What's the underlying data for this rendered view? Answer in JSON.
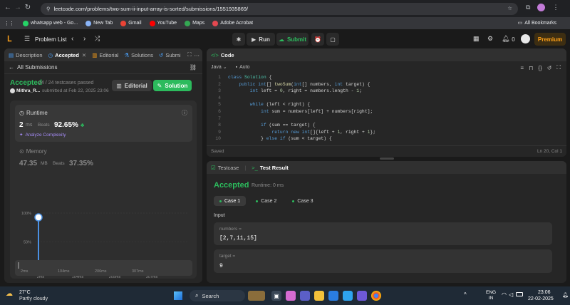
{
  "browser": {
    "url": "leetcode.com/problems/two-sum-ii-input-array-is-sorted/submissions/1551935869/",
    "bookmarks": [
      "whatsapp web - Go...",
      "New Tab",
      "Gmail",
      "YouTube",
      "Maps",
      "Adobe Acrobat"
    ],
    "all_bookmarks": "All Bookmarks"
  },
  "header": {
    "problem_list": "Problem List",
    "run": "Run",
    "submit": "Submit",
    "fire_count": "0",
    "premium": "Premium"
  },
  "left_tabs": {
    "description": "Description",
    "accepted": "Accepted",
    "editorial": "Editorial",
    "solutions": "Solutions",
    "submissions": "Submi"
  },
  "submission": {
    "all_submissions": "All Submissions",
    "status": "Accepted",
    "testcases": "24 / 24 testcases passed",
    "user": "Mithra_R...",
    "submitted_at": "submitted at Feb 22, 2025 23:06",
    "editorial_btn": "Editorial",
    "solution_btn": "Solution",
    "runtime_label": "Runtime",
    "runtime_value": "2",
    "runtime_unit": "ms",
    "beats_label": "Beats",
    "runtime_beats": "92.65%",
    "analyze": "Analyze Complexity",
    "memory_label": "Memory",
    "memory_value": "47.35",
    "memory_unit": "MB",
    "memory_beats": "37.35%"
  },
  "chart_data": {
    "type": "bar",
    "y_ticks": [
      "100%",
      "50%",
      "0%"
    ],
    "x_ticks": [
      "2ms",
      "104ms",
      "205ms",
      "307ms"
    ],
    "minimap_ticks": [
      "2ms",
      "104ms",
      "206ms",
      "307ms"
    ],
    "ylim": [
      0,
      100
    ],
    "highlight": {
      "x": "2ms",
      "value": 92.65
    }
  },
  "code_panel": {
    "title": "Code",
    "language": "Java",
    "mode": "Auto",
    "saved": "Saved",
    "cursor": "Ln 20, Col 1",
    "lines": [
      "class Solution {",
      "    public int[] twoSum(int[] numbers, int target) {",
      "        int left = 0, right = numbers.length - 1;",
      "",
      "        while (left < right) {",
      "            int sum = numbers[left] + numbers[right];",
      "",
      "            if (sum == target) {",
      "                return new int[]{left + 1, right + 1};",
      "            } else if (sum < target) {"
    ],
    "line_numbers": [
      "1",
      "2",
      "3",
      "4",
      "5",
      "6",
      "7",
      "8",
      "9",
      "10"
    ]
  },
  "test_panel": {
    "testcase_tab": "Testcase",
    "result_tab": "Test Result",
    "status": "Accepted",
    "runtime": "Runtime: 0 ms",
    "cases": [
      "Case 1",
      "Case 2",
      "Case 3"
    ],
    "input_label": "Input",
    "numbers_label": "numbers =",
    "numbers_value": "[2,7,11,15]",
    "target_label": "target =",
    "target_value": "9"
  },
  "taskbar": {
    "temp": "27°C",
    "weather": "Partly cloudy",
    "search": "Search",
    "lang1": "ENG",
    "lang2": "IN",
    "time": "23:06",
    "date": "22-02-2025"
  }
}
